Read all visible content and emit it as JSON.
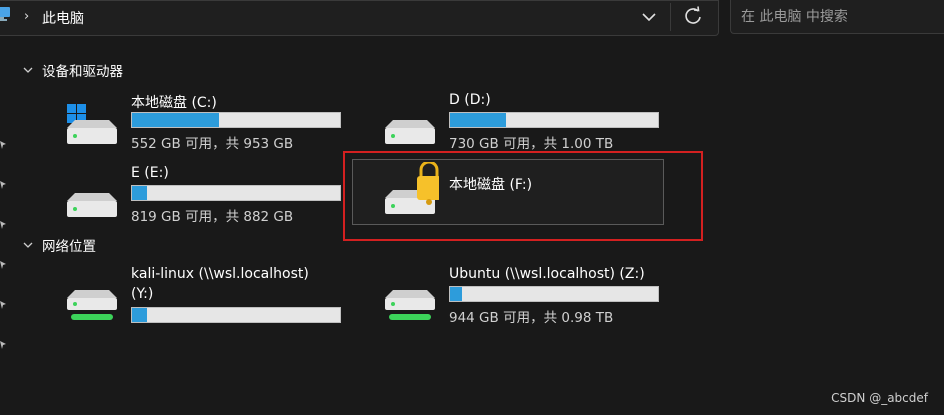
{
  "header": {
    "crumb_sep": "›",
    "breadcrumb": "此电脑",
    "search_placeholder": "在 此电脑 中搜索"
  },
  "sections": [
    {
      "title": "设备和驱动器"
    },
    {
      "title": "网络位置"
    }
  ],
  "drives": [
    {
      "name": "本地磁盘 (C:)",
      "used_fraction": 0.42,
      "info": "552 GB 可用，共 953 GB"
    },
    {
      "name": "D (D:)",
      "used_fraction": 0.27,
      "info": "730 GB 可用，共 1.00 TB"
    },
    {
      "name": "E (E:)",
      "used_fraction": 0.07,
      "info": "819 GB 可用，共 882 GB"
    },
    {
      "name": "本地磁盘 (F:)"
    }
  ],
  "network": [
    {
      "name": "kali-linux (\\\\wsl.localhost)",
      "name2": "(Y:)",
      "used_fraction": 0.07
    },
    {
      "name": "Ubuntu (\\\\wsl.localhost) (Z:)",
      "used_fraction": 0.06,
      "info": "944 GB 可用，共 0.98 TB"
    }
  ],
  "watermark": "CSDN @_abcdef",
  "colors": {
    "bar_fill": "#2d9cdb",
    "bar_bg": "#e6e6e6",
    "highlight": "#d32020",
    "background": "#191919"
  }
}
